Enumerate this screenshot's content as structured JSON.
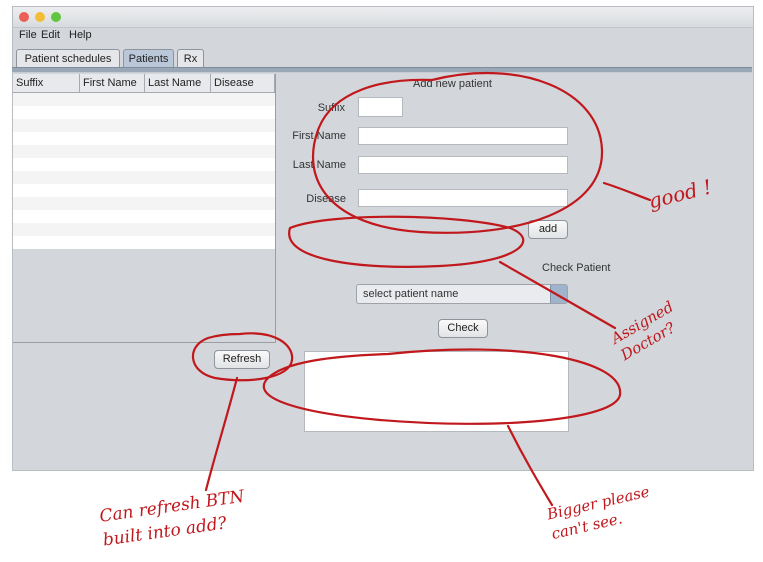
{
  "menu": [
    "File",
    "Edit",
    "Help"
  ],
  "tabs": [
    "Patient schedules",
    "Patients",
    "Rx"
  ],
  "table": {
    "columns": [
      "Suffix",
      "First Name",
      "Last Name",
      "Disease"
    ],
    "row_count": 12
  },
  "form": {
    "title": "Add new patient",
    "suffix_label": "Suffix",
    "first_name_label": "First Name",
    "last_name_label": "Last Name",
    "disease_label": "Disease",
    "add_button": "add"
  },
  "check_panel": {
    "title": "Check Patient",
    "select_value": "select patient name",
    "check_button": "Check"
  },
  "refresh_button": "Refresh",
  "annotations": {
    "good": "good !",
    "assigned_doctor": "Assigned\nDoctor?",
    "refresh_note": "Can refresh BTN\nbuilt into add?",
    "bigger_note": "Bigger please\ncan't see."
  },
  "colors": {
    "window_bg": "#d3d6da",
    "annotation_red": "#c0181c"
  }
}
